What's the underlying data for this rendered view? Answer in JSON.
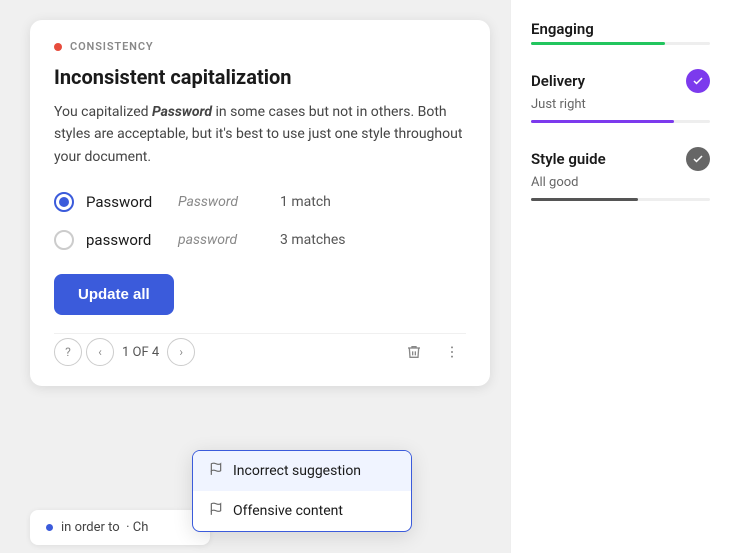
{
  "left_panel": {
    "category_label": "CONSISTENCY",
    "title": "Inconsistent capitalization",
    "description_before": "You capitalized ",
    "description_keyword": "Password",
    "description_after": " in some cases but not in others. Both styles are acceptable, but it's best to use just one style throughout your document.",
    "options": [
      {
        "label": "Password",
        "example": "Password",
        "count": "1 match",
        "selected": true
      },
      {
        "label": "password",
        "example": "password",
        "count": "3 matches",
        "selected": false
      }
    ],
    "update_button": "Update all",
    "nav": {
      "current": "1",
      "total": "4",
      "of_label": "OF"
    }
  },
  "dropdown": {
    "items": [
      {
        "label": "Incorrect suggestion",
        "icon": "flag"
      },
      {
        "label": "Offensive content",
        "icon": "flag"
      }
    ]
  },
  "bottom_row": {
    "text": "in order to",
    "suffix": "· Ch"
  },
  "right_panel": {
    "metrics": [
      {
        "name": "Engaging",
        "sub": "",
        "bar_color": "#22c55e",
        "bar_width": "75%",
        "has_check": false
      },
      {
        "name": "Delivery",
        "sub": "Just right",
        "bar_color": "#7c3aed",
        "bar_width": "80%",
        "has_check": true,
        "check_type": "purple"
      },
      {
        "name": "Style guide",
        "sub": "All good",
        "bar_color": "#555",
        "bar_width": "60%",
        "has_check": true,
        "check_type": "gray"
      }
    ]
  }
}
